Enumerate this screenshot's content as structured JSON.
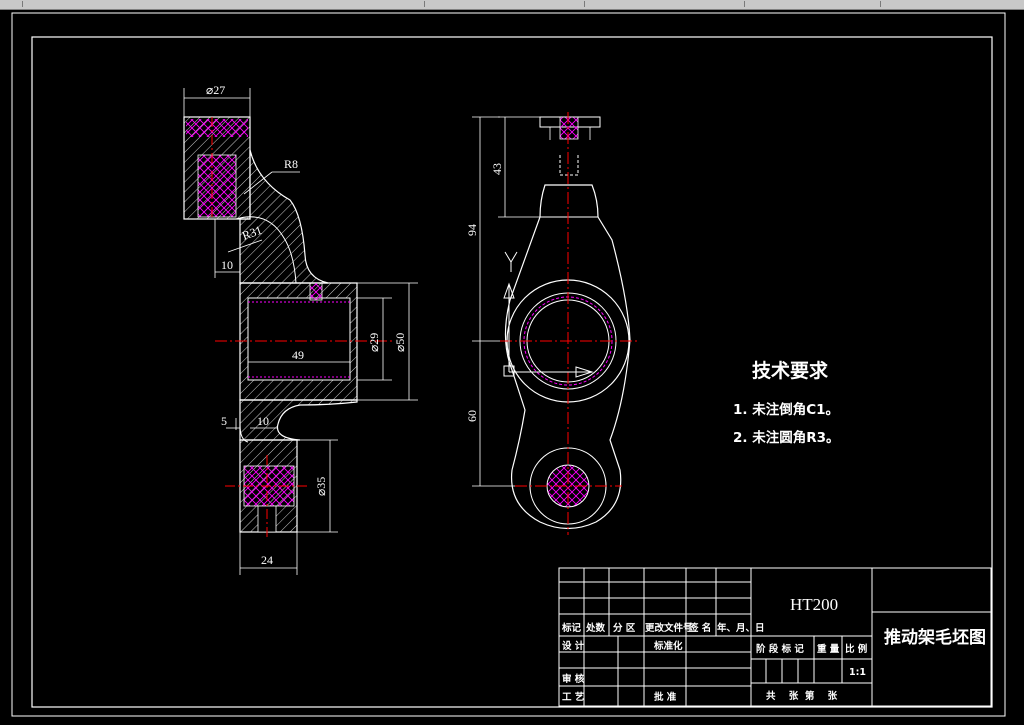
{
  "left_view": {
    "dims": {
      "d27": "⌀27",
      "r8": "R8",
      "r31": "R31",
      "d10a": "10",
      "d49": "49",
      "d29": "⌀29",
      "d50": "⌀50",
      "d5": "5",
      "d10b": "10",
      "d35": "⌀35",
      "d24": "24"
    }
  },
  "right_view": {
    "dims": {
      "d43": "43",
      "d94": "94",
      "d60": "60",
      "y_axis": "Y"
    }
  },
  "technical_requirements": {
    "title": "技术要求",
    "items": [
      "1. 未注倒角C1。",
      "2. 未注圆角R3。"
    ]
  },
  "title_block": {
    "material": "HT200",
    "drawing_name": "推动架毛坯图",
    "row_header": [
      "标记",
      "处数",
      "分 区",
      "更改文件号",
      "签 名",
      "年、月、日"
    ],
    "design_label": "设 计",
    "standardize_label": "标准化",
    "review_label": "审 核",
    "process_label": "工 艺",
    "approve_label": "批 准",
    "stage_label": "阶 段 标 记",
    "weight_label": "重 量",
    "scale_label": "比 例",
    "scale_value": "1:1",
    "sheets_label": "共    张  第    张"
  },
  "colors": {
    "background": "#000000",
    "lines": "#ffffff",
    "centerline": "#ff0000",
    "hatch": "#ff00ff"
  }
}
